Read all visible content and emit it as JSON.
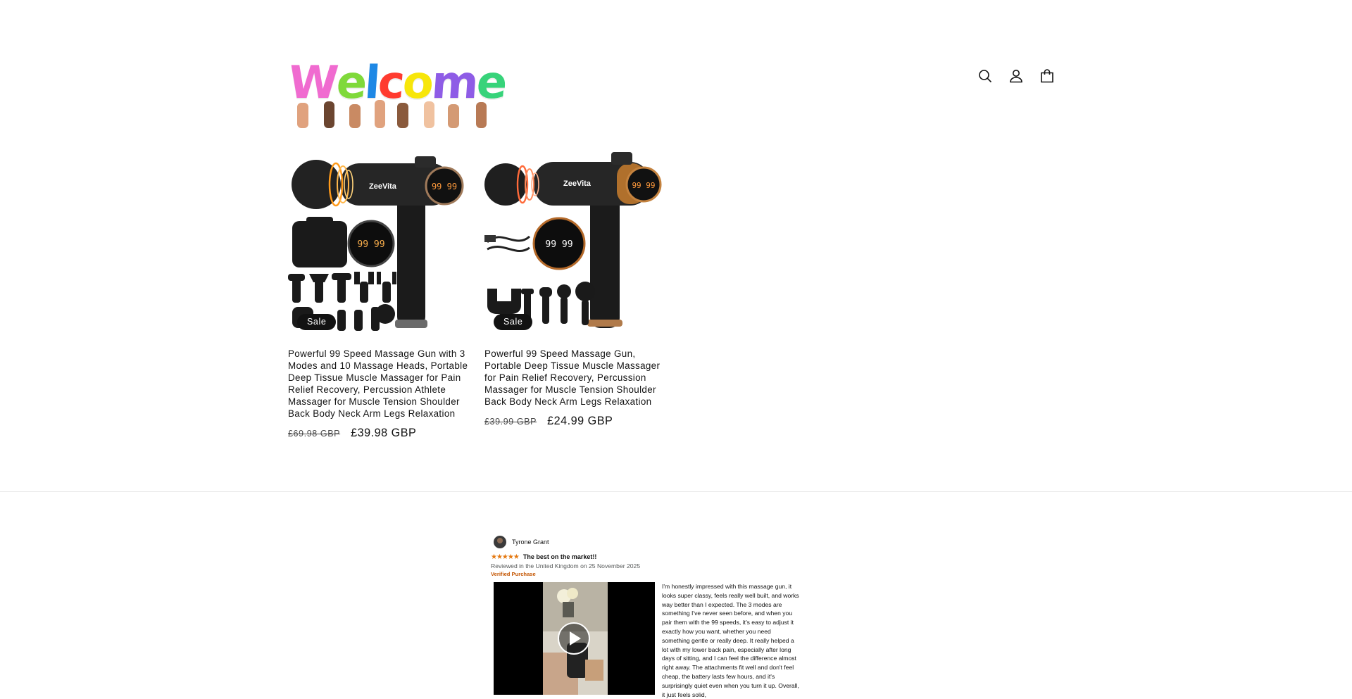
{
  "header": {
    "logo_text": "Welcome",
    "logo_letters": [
      {
        "char": "W",
        "color": "#f06bd0"
      },
      {
        "char": "e",
        "color": "#7fd93a"
      },
      {
        "char": "l",
        "color": "#1e88e5"
      },
      {
        "char": "c",
        "color": "#ff3b2f"
      },
      {
        "char": "o",
        "color": "#f7e60a"
      },
      {
        "char": "m",
        "color": "#8e5ce6"
      },
      {
        "char": "e",
        "color": "#37d37a"
      }
    ],
    "icons": [
      "search-icon",
      "account-icon",
      "cart-icon"
    ]
  },
  "products": [
    {
      "badge": "Sale",
      "title": "Powerful 99 Speed Massage Gun with 3 Modes and 10 Massage Heads, Portable Deep Tissue Muscle Massager for Pain Relief Recovery, Percussion Athlete Massager for Muscle Tension Shoulder Back Body Neck Arm Legs Relaxation",
      "price_old": "£69.98 GBP",
      "price_new": "£39.98 GBP",
      "image_brand": "ZeeVita",
      "display_digits": "99 99"
    },
    {
      "badge": "Sale",
      "title": "Powerful 99 Speed Massage Gun, Portable Deep Tissue Muscle Massager for Pain Relief Recovery, Percussion Massager for Muscle Tension Shoulder Back Body Neck Arm Legs Relaxation",
      "price_old": "£39.99 GBP",
      "price_new": "£24.99 GBP",
      "image_brand": "ZeeVita",
      "display_digits": "99 99"
    }
  ],
  "review": {
    "reviewer": "Tyrone Grant",
    "stars": "★★★★★",
    "title": "The best on the market!!",
    "meta": "Reviewed in the United Kingdom on 25 November 2025",
    "verified": "Verified Purchase",
    "body": "I'm honestly impressed with this massage gun, it looks super classy, feels really well built, and works way better than I expected. The 3 modes are something I've never seen before, and when you pair them with the 99 speeds, it's easy to adjust it exactly how you want, whether you need something gentle or really deep. It really helped a lot with my lower back pain, especially after long days of sitting, and I can feel the difference almost right away. The attachments fit well and don't feel cheap, the battery lasts few hours, and it's surprisingly quiet even when you turn it up. Overall, it just feels solid,"
  }
}
